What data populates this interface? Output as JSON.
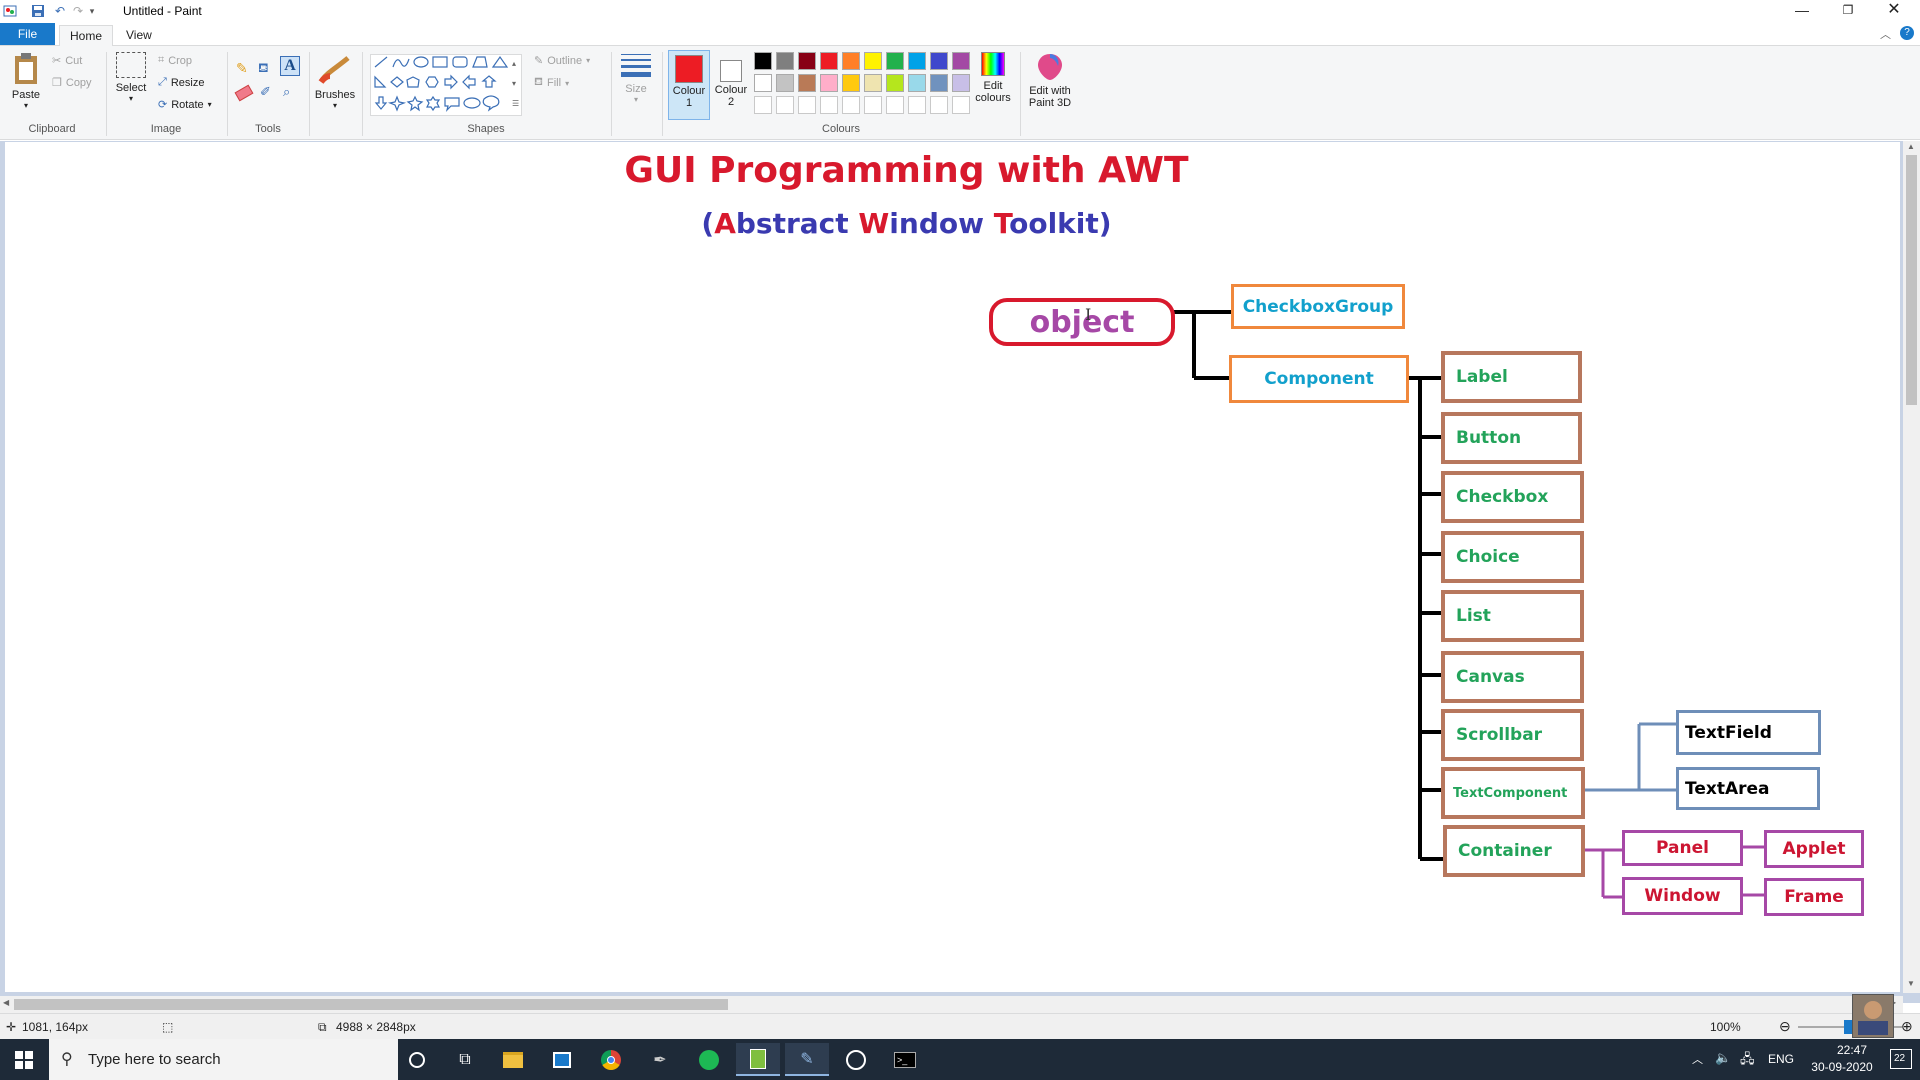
{
  "window": {
    "title": "Untitled - Paint",
    "controls": [
      "minimize",
      "restore",
      "close"
    ]
  },
  "tabs": {
    "file": "File",
    "home": "Home",
    "view": "View"
  },
  "ribbon": {
    "clipboard": {
      "label": "Clipboard",
      "paste": "Paste",
      "cut": "Cut",
      "copy": "Copy"
    },
    "image": {
      "label": "Image",
      "select": "Select",
      "crop": "Crop",
      "resize": "Resize",
      "rotate": "Rotate"
    },
    "tools": {
      "label": "Tools"
    },
    "brushes": {
      "label": "Brushes"
    },
    "shapes": {
      "label": "Shapes",
      "outline": "Outline",
      "fill": "Fill"
    },
    "size": {
      "label": "Size"
    },
    "colours": {
      "label": "Colours",
      "colour1": "Colour 1",
      "colour2": "Colour 2",
      "colour1_value": "#ed1c24",
      "colour2_value": "#ffffff",
      "edit_colours": "Edit colours",
      "palette_row1": [
        "#000000",
        "#7f7f7f",
        "#880015",
        "#ed1c24",
        "#ff7f27",
        "#fff200",
        "#22b14c",
        "#00a2e8",
        "#3f48cc",
        "#a349a4"
      ],
      "palette_row2": [
        "#ffffff",
        "#c3c3c3",
        "#b97a57",
        "#ffaec9",
        "#ffc90e",
        "#efe4b0",
        "#b5e61d",
        "#99d9ea",
        "#7092be",
        "#c8bfe7"
      ]
    },
    "paint3d": "Edit with Paint 3D"
  },
  "diagram": {
    "title": "GUI Programming with AWT",
    "subtitle_parts": [
      {
        "text": "(",
        "color": "#3a3ab0"
      },
      {
        "text": "A",
        "color": "#d8192d"
      },
      {
        "text": "bstract ",
        "color": "#3a3ab0"
      },
      {
        "text": "W",
        "color": "#d8192d"
      },
      {
        "text": "indow ",
        "color": "#3a3ab0"
      },
      {
        "text": "T",
        "color": "#d8192d"
      },
      {
        "text": "oolkit)",
        "color": "#3a3ab0"
      }
    ],
    "root": "object",
    "level1": [
      "CheckboxGroup",
      "Component"
    ],
    "components": [
      "Label",
      "Button",
      "Checkbox",
      "Choice",
      "List",
      "Canvas",
      "Scrollbar",
      "TextComponent",
      "Container"
    ],
    "text_components": [
      "TextField",
      "TextArea"
    ],
    "containers": [
      "Panel",
      "Window"
    ],
    "sub_containers": [
      "Applet",
      "Frame"
    ]
  },
  "status": {
    "cursor": "1081, 164px",
    "size": "4988 × 2848px",
    "zoom": "100%"
  },
  "taskbar": {
    "search_placeholder": "Type here to search",
    "language": "ENG",
    "time": "22:47",
    "date": "30-09-2020",
    "notifications": "22"
  }
}
